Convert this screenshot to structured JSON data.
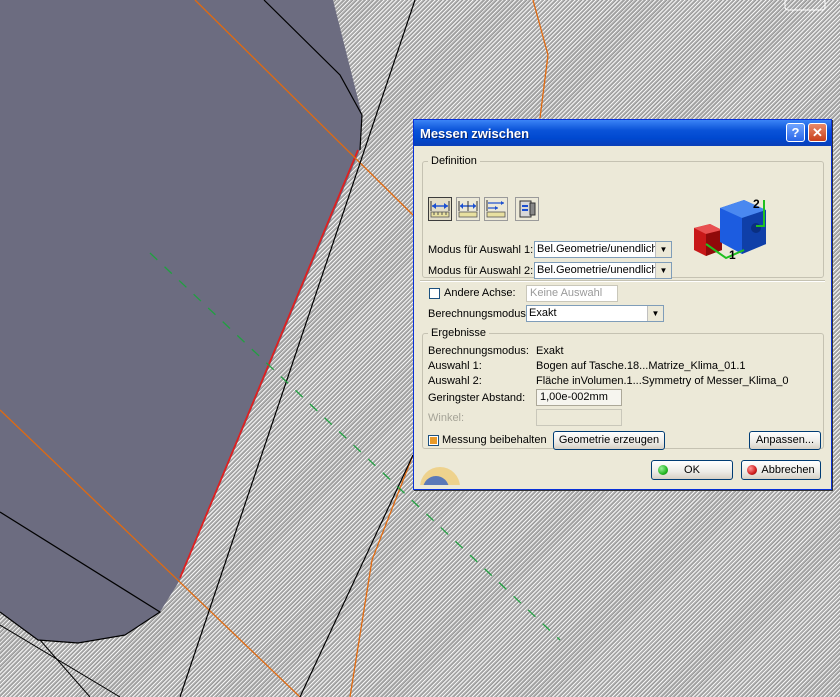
{
  "dialog": {
    "title": "Messen zwischen",
    "help_label": "?",
    "close_label": "✕"
  },
  "definition": {
    "legend": "Definition",
    "tools": [
      {
        "icon": "measure-between-icon",
        "active": true
      },
      {
        "icon": "measure-chain-icon",
        "active": false
      },
      {
        "icon": "measure-fan-icon",
        "active": false
      },
      {
        "icon": "measure-customize-icon",
        "active": false
      }
    ],
    "mode1_label": "Modus für Auswahl 1:",
    "mode1_value": "Bel.Geometrie/unendlich",
    "mode2_label": "Modus für Auswahl 2:",
    "mode2_value": "Bel.Geometrie/unendlich",
    "preview_label1": "1",
    "preview_label2": "2"
  },
  "options": {
    "other_axis_label": "Andere Achse:",
    "other_axis_checked": false,
    "other_axis_value": "Keine Auswahl",
    "calc_mode_label": "Berechnungsmodus:",
    "calc_mode_value": "Exakt"
  },
  "results": {
    "legend": "Ergebnisse",
    "calc_mode_label": "Berechnungsmodus:",
    "calc_mode_value": "Exakt",
    "selection1_label": "Auswahl 1:",
    "selection1_value": "Bogen auf Tasche.18...Matrize_Klima_01.1",
    "selection2_label": "Auswahl 2:",
    "selection2_value": "Fläche inVolumen.1...Symmetry of Messer_Klima_0",
    "min_distance_label": "Geringster Abstand:",
    "min_distance_value": "1,00e-002mm",
    "angle_label": "Winkel:",
    "angle_value": ""
  },
  "footer": {
    "keep_measure_label": "Messung beibehalten",
    "keep_measure_checked": true,
    "create_geometry_label": "Geometrie erzeugen",
    "customize_label": "Anpassen...",
    "ok_label": "OK",
    "cancel_label": "Abbrechen"
  },
  "colors": {
    "titlebar": "#0a53d8",
    "dialog_bg": "#ece9d8",
    "part_face": "#6c6c80",
    "edge_orange": "#e06a10",
    "edge_red": "#e02020",
    "edge_black": "#000000",
    "axis_green": "#20a040",
    "ok_led": "#22b822",
    "cancel_led": "#d01c1c"
  }
}
